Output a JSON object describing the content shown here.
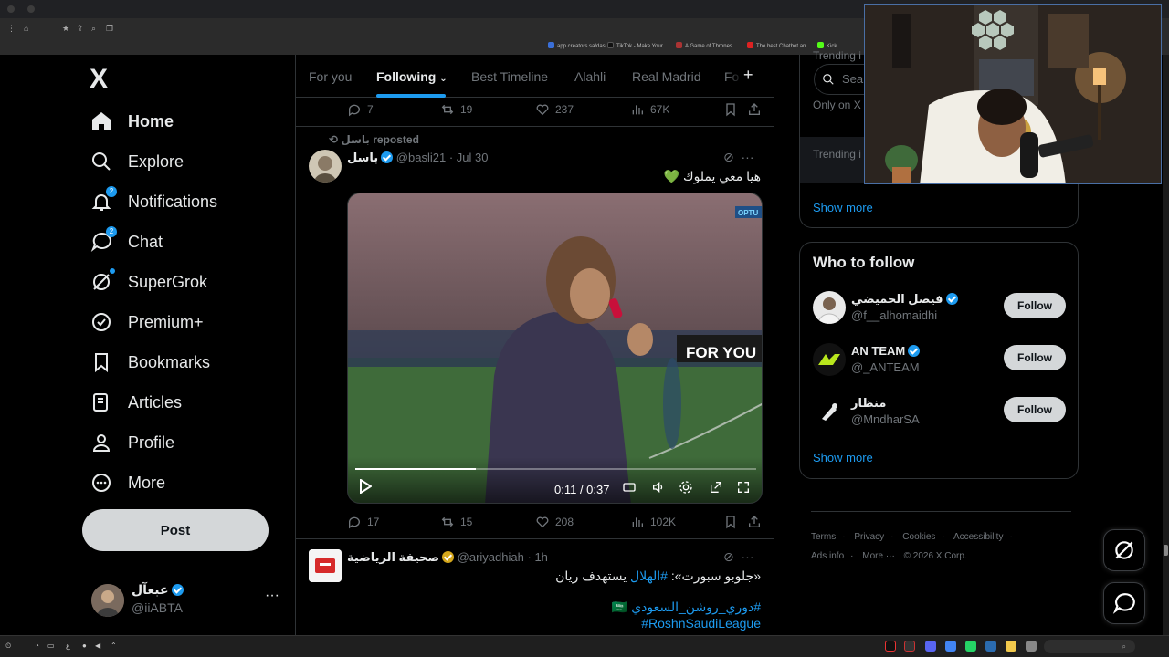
{
  "browser": {
    "bookmarks": [
      {
        "label": "app.creators.sa/das...",
        "color": "#3a6fd8"
      },
      {
        "label": "TikTok - Make Your...",
        "color": "#111111"
      },
      {
        "label": "A Game of Thrones...",
        "color": "#aa3333"
      },
      {
        "label": "The best Chatbot an...",
        "color": "#dd2222"
      },
      {
        "label": "Kick",
        "color": "#53fc18"
      }
    ]
  },
  "nav": {
    "logo": "X",
    "items": [
      {
        "label": "Home",
        "icon": "home-icon",
        "active": true
      },
      {
        "label": "Explore",
        "icon": "search-icon"
      },
      {
        "label": "Notifications",
        "icon": "bell-icon",
        "badge": "2"
      },
      {
        "label": "Chat",
        "icon": "chat-icon",
        "badge": "2"
      },
      {
        "label": "SuperGrok",
        "icon": "grok-icon"
      },
      {
        "label": "Premium+",
        "icon": "premium-icon"
      },
      {
        "label": "Bookmarks",
        "icon": "bookmark-icon"
      },
      {
        "label": "Articles",
        "icon": "articles-icon"
      },
      {
        "label": "Profile",
        "icon": "profile-icon"
      },
      {
        "label": "More",
        "icon": "more-circle-icon"
      }
    ],
    "post_label": "Post",
    "account": {
      "name": "عبعآل",
      "handle": "@iiABTA",
      "more": "···"
    }
  },
  "tabs": {
    "items": [
      "For you",
      "Following",
      "Best Timeline",
      "Alahli",
      "Real Madrid",
      "Fo"
    ],
    "active": "Following",
    "plus": "+"
  },
  "feed": {
    "top_actions": {
      "replies": "7",
      "reposts": "19",
      "likes": "237",
      "views": "67K"
    },
    "tweet1": {
      "repost_by": "باسل reposted",
      "name": "باسل",
      "handle": "@basli21",
      "sep": "·",
      "time": "Jul 30",
      "text": "هيا معي يملوك 💚",
      "video": {
        "time": "0:11 / 0:37",
        "progress": 0.3,
        "badge": "OPTU",
        "banner": "FOR YOU"
      },
      "actions": {
        "replies": "17",
        "reposts": "15",
        "likes": "208",
        "views": "102K"
      }
    },
    "tweet2": {
      "name": "صحيفة الرياضية",
      "handle": "@ariyadhiah",
      "sep": "·",
      "time": "1h",
      "line1_prefix": "«جلوبو سبورت»: ",
      "line1_tag": "#الهلال",
      "line1_suffix": " يستهدف ريان",
      "line2_tag": "#دوري_روشن_السعودي",
      "line2_flag": "🇸🇦",
      "line3_tag": "#RoshnSaudiLeague"
    }
  },
  "sidebar": {
    "search_placeholder": "Search",
    "trends": [
      {
        "category": "Trending i"
      },
      {
        "category": "Only on X"
      },
      {
        "category": "Trending i"
      }
    ],
    "show_more": "Show more",
    "who_to_follow": {
      "title": "Who to follow",
      "users": [
        {
          "name": "فيصل الحميضي",
          "handle": "@f__alhomaidhi",
          "verified": "blue"
        },
        {
          "name": "AN TEAM",
          "handle": "@_ANTEAM",
          "verified": "blue"
        },
        {
          "name": "منظار",
          "handle": "@MndharSA",
          "verified": "none"
        }
      ],
      "follow_label": "Follow",
      "show_more": "Show more"
    },
    "footer": [
      "Terms",
      "Privacy",
      "Cookies",
      "Accessibility",
      "Ads info",
      "More ···",
      "© 2026 X Corp."
    ]
  },
  "colors": {
    "accent": "#1d9bf0",
    "background": "#000000",
    "border": "#2f3336",
    "muted": "#71767b"
  }
}
